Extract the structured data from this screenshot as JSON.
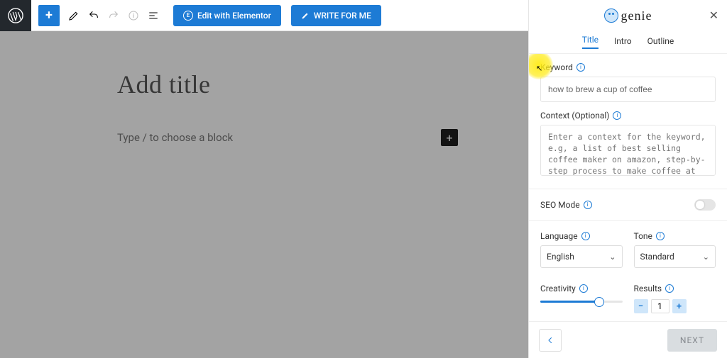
{
  "toolbar": {
    "edit_elementor_label": "Edit with Elementor",
    "write_for_me_label": "WRITE FOR ME"
  },
  "editor": {
    "title_placeholder": "Add title",
    "block_placeholder": "Type / to choose a block"
  },
  "panel": {
    "brand": "genie",
    "tabs": {
      "title": "Title",
      "intro": "Intro",
      "outline": "Outline"
    },
    "keyword": {
      "label": "Keyword",
      "value": "how to brew a cup of coffee"
    },
    "context": {
      "label": "Context (Optional)",
      "placeholder": "Enter a context for the keyword, e.g, a list of best selling coffee maker on amazon, step-by-step process to make coffee at home, etc."
    },
    "seo_mode_label": "SEO Mode",
    "language": {
      "label": "Language",
      "value": "English"
    },
    "tone": {
      "label": "Tone",
      "value": "Standard"
    },
    "creativity": {
      "label": "Creativity",
      "percent": 72
    },
    "results": {
      "label": "Results",
      "value": "1"
    },
    "footer": {
      "next_label": "NEXT"
    }
  }
}
